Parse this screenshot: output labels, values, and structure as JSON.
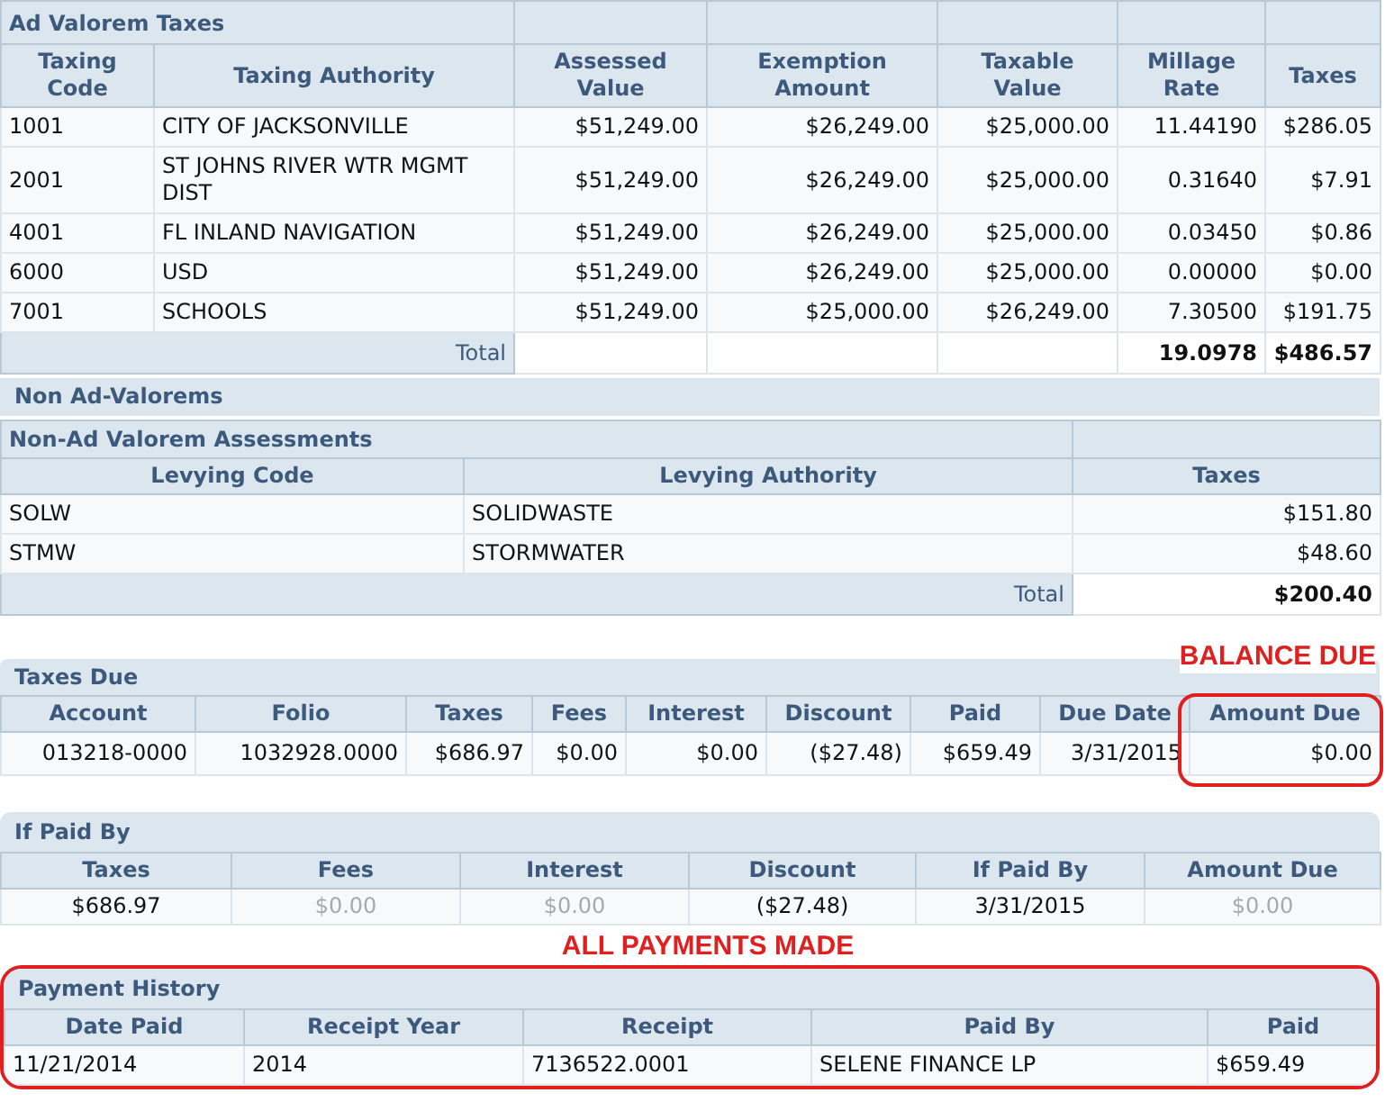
{
  "ad_valorem": {
    "title": "Ad Valorem Taxes",
    "columns": [
      "Taxing Code",
      "Taxing Authority",
      "Assessed Value",
      "Exemption Amount",
      "Taxable Value",
      "Millage Rate",
      "Taxes"
    ],
    "rows": [
      [
        "1001",
        "CITY OF JACKSONVILLE",
        "$51,249.00",
        "$26,249.00",
        "$25,000.00",
        "11.44190",
        "$286.05"
      ],
      [
        "2001",
        "ST JOHNS RIVER WTR MGMT DIST",
        "$51,249.00",
        "$26,249.00",
        "$25,000.00",
        "0.31640",
        "$7.91"
      ],
      [
        "4001",
        "FL INLAND NAVIGATION",
        "$51,249.00",
        "$26,249.00",
        "$25,000.00",
        "0.03450",
        "$0.86"
      ],
      [
        "6000",
        "USD",
        "$51,249.00",
        "$26,249.00",
        "$25,000.00",
        "0.00000",
        "$0.00"
      ],
      [
        "7001",
        "SCHOOLS",
        "$51,249.00",
        "$25,000.00",
        "$26,249.00",
        "7.30500",
        "$191.75"
      ]
    ],
    "total_label": "Total",
    "total_millage": "19.0978",
    "total_taxes": "$486.57"
  },
  "non_ad_valorem": {
    "section_title": "Non Ad-Valorems",
    "title": "Non-Ad Valorem Assessments",
    "columns": [
      "Levying Code",
      "Levying Authority",
      "Taxes"
    ],
    "rows": [
      [
        "SOLW",
        "SOLIDWASTE",
        "$151.80"
      ],
      [
        "STMW",
        "STORMWATER",
        "$48.60"
      ]
    ],
    "total_label": "Total",
    "total_taxes": "$200.40"
  },
  "taxes_due": {
    "title": "Taxes Due",
    "annotation": "BALANCE DUE",
    "highlighted": true,
    "columns": [
      "Account",
      "Folio",
      "Taxes",
      "Fees",
      "Interest",
      "Discount",
      "Paid",
      "Due Date",
      "Amount Due"
    ],
    "rows": [
      [
        "013218-0000",
        "1032928.0000",
        "$686.97",
        "$0.00",
        "$0.00",
        "($27.48)",
        "$659.49",
        "3/31/2015",
        "$0.00"
      ]
    ]
  },
  "if_paid_by": {
    "title": "If Paid By",
    "columns": [
      "Taxes",
      "Fees",
      "Interest",
      "Discount",
      "If Paid By",
      "Amount Due"
    ],
    "cells": [
      {
        "text": "$686.97",
        "muted": false
      },
      {
        "text": "$0.00",
        "muted": true
      },
      {
        "text": "$0.00",
        "muted": true
      },
      {
        "text": "($27.48)",
        "muted": false
      },
      {
        "text": "3/31/2015",
        "muted": false
      },
      {
        "text": "$0.00",
        "muted": true
      }
    ]
  },
  "payment_history": {
    "title": "Payment History",
    "annotation": "ALL PAYMENTS MADE",
    "highlighted": true,
    "columns": [
      "Date Paid",
      "Receipt Year",
      "Receipt",
      "Paid By",
      "Paid"
    ],
    "rows": [
      [
        "11/21/2014",
        "2014",
        "7136522.0001",
        "SELENE FINANCE LP",
        "$659.49"
      ]
    ]
  }
}
